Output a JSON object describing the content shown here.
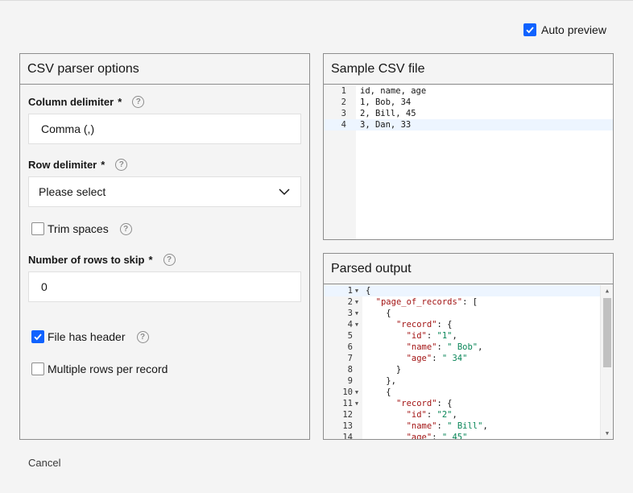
{
  "auto_preview": {
    "label": "Auto preview",
    "checked": true
  },
  "options": {
    "title": "CSV parser options",
    "column_delimiter": {
      "label": "Column delimiter",
      "required": "*",
      "value": "Comma (,)"
    },
    "row_delimiter": {
      "label": "Row delimiter",
      "required": "*",
      "placeholder": "Please select"
    },
    "trim_spaces": {
      "label": "Trim spaces",
      "checked": false
    },
    "rows_to_skip": {
      "label": "Number of rows to skip",
      "required": "*",
      "value": "0"
    },
    "file_has_header": {
      "label": "File has header",
      "checked": true
    },
    "multiple_rows": {
      "label": "Multiple rows per record",
      "checked": false
    }
  },
  "sample": {
    "title": "Sample CSV file",
    "lines": [
      {
        "num": "1",
        "text": "id, name, age"
      },
      {
        "num": "2",
        "text": "1, Bob, 34"
      },
      {
        "num": "3",
        "text": "2, Bill, 45"
      },
      {
        "num": "4",
        "text": "3, Dan, 33"
      }
    ]
  },
  "parsed": {
    "title": "Parsed output",
    "lines": [
      {
        "num": "1",
        "fold": "▼",
        "text": "{"
      },
      {
        "num": "2",
        "fold": "▼",
        "text": "  \"page_of_records\": ["
      },
      {
        "num": "3",
        "fold": "▼",
        "text": "    {"
      },
      {
        "num": "4",
        "fold": "▼",
        "text": "      \"record\": {"
      },
      {
        "num": "5",
        "fold": "",
        "text": "        \"id\": \"1\","
      },
      {
        "num": "6",
        "fold": "",
        "text": "        \"name\": \" Bob\","
      },
      {
        "num": "7",
        "fold": "",
        "text": "        \"age\": \" 34\""
      },
      {
        "num": "8",
        "fold": "",
        "text": "      }"
      },
      {
        "num": "9",
        "fold": "",
        "text": "    },"
      },
      {
        "num": "10",
        "fold": "▼",
        "text": "    {"
      },
      {
        "num": "11",
        "fold": "▼",
        "text": "      \"record\": {"
      },
      {
        "num": "12",
        "fold": "",
        "text": "        \"id\": \"2\","
      },
      {
        "num": "13",
        "fold": "",
        "text": "        \"name\": \" Bill\","
      },
      {
        "num": "14",
        "fold": "",
        "text": "        \"age\": \" 45\""
      }
    ]
  },
  "cancel_label": "Cancel",
  "colors": {
    "accent": "#0f62fe",
    "border": "#8d8d8d",
    "background": "#f4f4f4"
  }
}
